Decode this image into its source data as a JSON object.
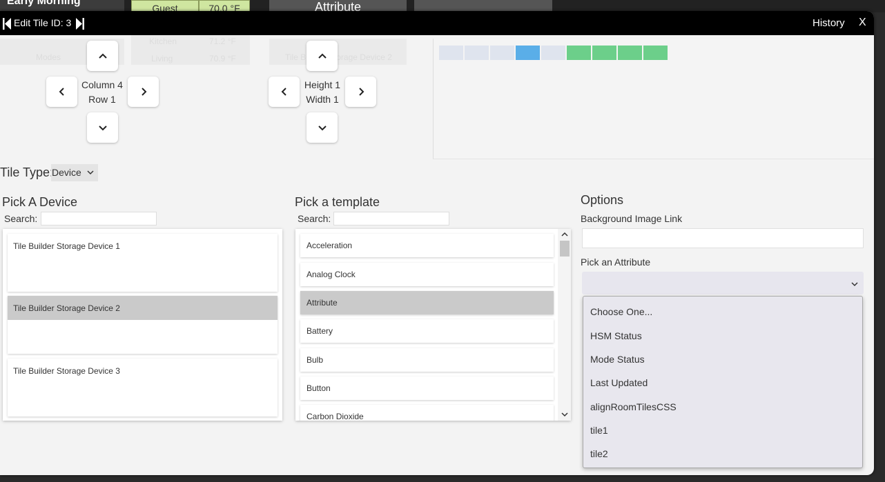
{
  "background": {
    "tile1": "Early Morning",
    "tile2": "Guest",
    "tile3": "70.0 °F",
    "tile4": "Attribute",
    "ghost_modes": "Modes",
    "ghost_kitchen": "Kitchen",
    "ghost_kitchen_temp": "71.2 °F",
    "ghost_living": "Living",
    "ghost_living_temp": "70.9 °F",
    "ghost_tile_storage": "Tile Builder Storage Device 2"
  },
  "titlebar": {
    "title": "Edit Tile ID: 3",
    "history": "History",
    "close": "X"
  },
  "position": {
    "column": "Column 4",
    "row": "Row 1"
  },
  "size": {
    "height": "Height 1",
    "width": "Width 1"
  },
  "preview": {
    "colors": {
      "light": "#dfe4ee",
      "selected": "#5aaee8",
      "green": "#6ccf8a"
    }
  },
  "tile_type": {
    "label": "Tile Type:",
    "value": "Device"
  },
  "device_panel": {
    "title": "Pick A Device",
    "search_label": "Search:",
    "items": [
      "Tile Builder Storage Device 1",
      "Tile Builder Storage Device 2",
      "Tile Builder Storage Device 3"
    ]
  },
  "template_panel": {
    "title": "Pick a template",
    "search_label": "Search:",
    "items": [
      "Acceleration",
      "Analog Clock",
      "Attribute",
      "Battery",
      "Bulb",
      "Button",
      "Carbon Dioxide"
    ]
  },
  "options_panel": {
    "title": "Options",
    "bg_image_label": "Background Image Link",
    "attribute_label": "Pick an Attribute",
    "attribute_options": [
      "Choose One...",
      "HSM Status",
      "Mode Status",
      "Last Updated",
      "alignRoomTilesCSS",
      "tile1",
      "tile2"
    ]
  }
}
